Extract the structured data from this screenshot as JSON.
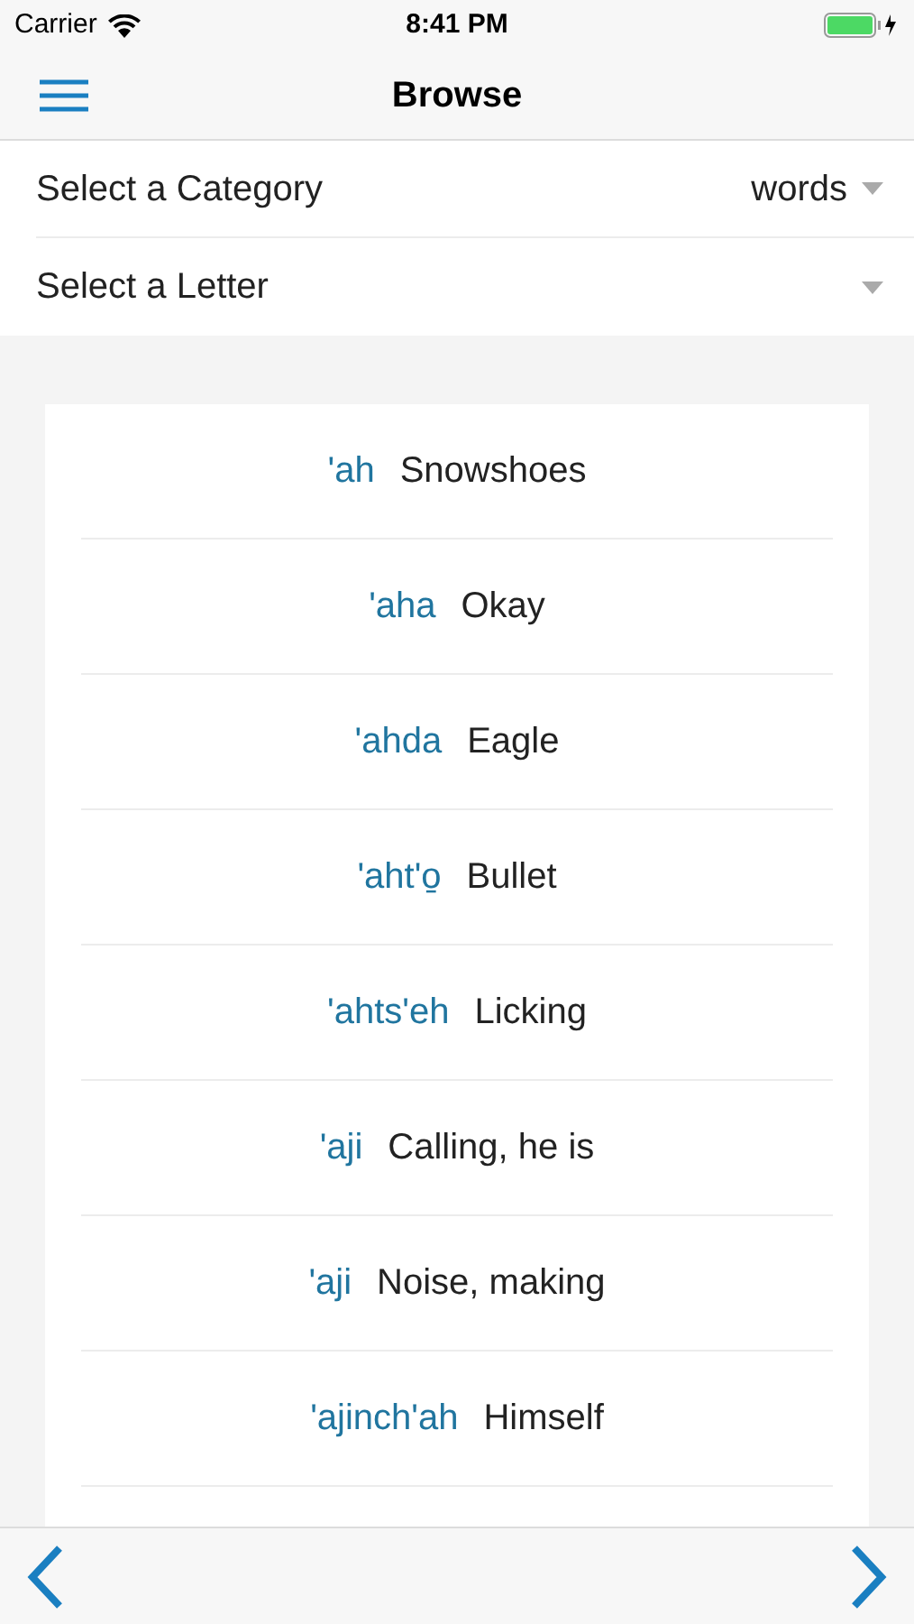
{
  "status_bar": {
    "carrier": "Carrier",
    "time": "8:41 PM"
  },
  "nav": {
    "title": "Browse"
  },
  "filters": [
    {
      "label": "Select a Category",
      "value": "words"
    },
    {
      "label": "Select a Letter"
    }
  ],
  "entries": [
    {
      "word": "'ah",
      "meaning": "Snowshoes"
    },
    {
      "word": "'aha",
      "meaning": "Okay"
    },
    {
      "word": "'ahda",
      "meaning": "Eagle"
    },
    {
      "word": "'aht'o̱",
      "meaning": "Bullet"
    },
    {
      "word": "'ahts'eh",
      "meaning": "Licking"
    },
    {
      "word": "'aji",
      "meaning": "Calling, he is"
    },
    {
      "word": "'aji",
      "meaning": "Noise, making"
    },
    {
      "word": "'ajinch'ah",
      "meaning": "Himself"
    }
  ]
}
